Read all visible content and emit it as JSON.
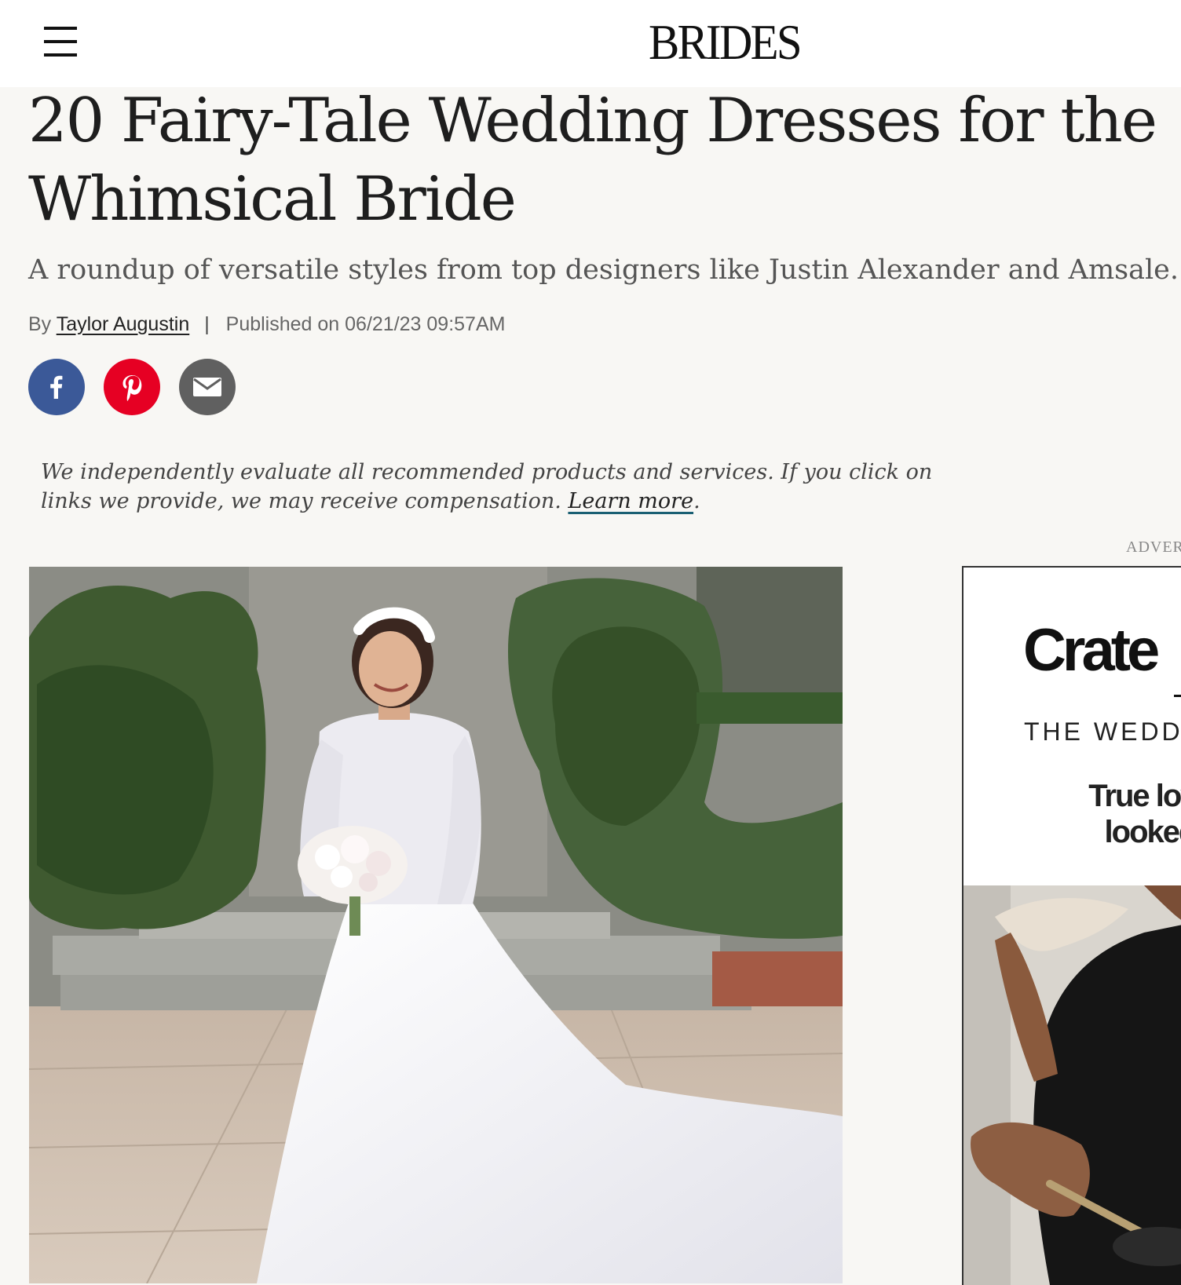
{
  "site": {
    "logo": "BRIDES"
  },
  "article": {
    "title": "20 Fairy-Tale Wedding Dresses for the Whimsical Bride",
    "subtitle": "A roundup of versatile styles from top designers like Justin Alexander and Amsale.",
    "byline": {
      "by_label": "By",
      "author": "Taylor Augustin",
      "separator": "|",
      "published": "Published on 06/21/23 09:57AM"
    },
    "disclaimer": {
      "text": "We independently evaluate all recommended products and services. If you click on links we provide, we may receive compensation. ",
      "link_label": "Learn more",
      "trailing": "."
    }
  },
  "share": {
    "items": [
      {
        "network": "facebook",
        "icon": "facebook-icon",
        "color": "#3b5998"
      },
      {
        "network": "pinterest",
        "icon": "pinterest-icon",
        "color": "#e60023"
      },
      {
        "network": "email",
        "icon": "email-icon",
        "color": "#606060"
      }
    ]
  },
  "advertisement": {
    "label": "ADVER",
    "brand": "Crate",
    "subline": "THE WEDDI",
    "tagline_line1": "True love",
    "tagline_line2": "looked"
  },
  "icons": {
    "menu": "menu-icon"
  },
  "colors": {
    "page_background": "#f8f7f4",
    "header_background": "#ffffff",
    "learn_more_underline": "#1a5f73"
  }
}
